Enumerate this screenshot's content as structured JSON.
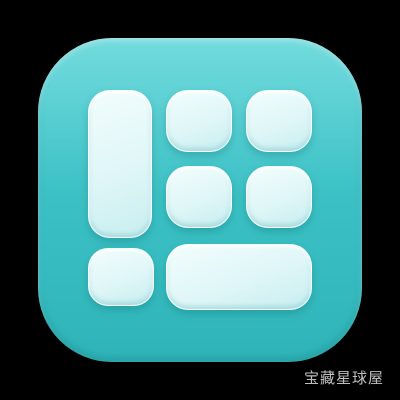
{
  "app_icon": {
    "icon_name": "grid-layout-icon",
    "background_color": "#3cc2c6",
    "tile_color": "#e4f8f9",
    "tiles": [
      {
        "name": "tile-tall"
      },
      {
        "name": "tile-top-mid"
      },
      {
        "name": "tile-top-right"
      },
      {
        "name": "tile-mid-mid"
      },
      {
        "name": "tile-mid-right"
      },
      {
        "name": "tile-bot-left"
      },
      {
        "name": "tile-bot-wide"
      }
    ]
  },
  "watermark": {
    "text": "宝藏星球屋"
  }
}
